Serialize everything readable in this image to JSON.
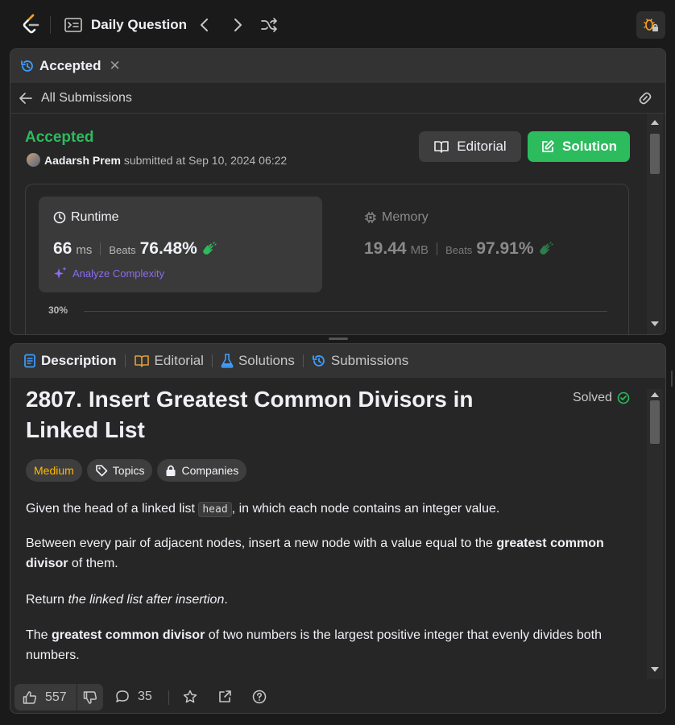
{
  "nav": {
    "title": "Daily Question",
    "logo_icon": "leetcode-logo-icon",
    "list_icon": "list-icon",
    "prev_icon": "chevron-left-icon",
    "next_icon": "chevron-right-icon",
    "shuffle_icon": "shuffle-icon",
    "debug_icon": "bug-lock-icon"
  },
  "submission_panel": {
    "tab_label": "Accepted",
    "back_label": "All Submissions",
    "status": "Accepted",
    "user": "Aadarsh Prem",
    "submitted_text": "submitted at Sep 10, 2024 06:22",
    "editorial_button": "Editorial",
    "solution_button": "Solution",
    "runtime": {
      "label": "Runtime",
      "value": "66",
      "unit": "ms",
      "beats_label": "Beats",
      "beats_value": "76.48%"
    },
    "memory": {
      "label": "Memory",
      "value": "19.44",
      "unit": "MB",
      "beats_label": "Beats",
      "beats_value": "97.91%"
    },
    "analyze_label": "Analyze Complexity",
    "chart_axis_label": "30%"
  },
  "description_panel": {
    "tabs": [
      {
        "label": "Description",
        "active": true
      },
      {
        "label": "Editorial",
        "active": false
      },
      {
        "label": "Solutions",
        "active": false
      },
      {
        "label": "Submissions",
        "active": false
      }
    ],
    "problem_title": "2807. Insert Greatest Common Divisors in Linked List",
    "solved_label": "Solved",
    "difficulty": "Medium",
    "topics_label": "Topics",
    "companies_label": "Companies",
    "para1_pre": "Given the head of a linked list ",
    "para1_code": "head",
    "para1_post": ", in which each node contains an integer value.",
    "para2_pre": "Between every pair of adjacent nodes, insert a new node with a value equal to the ",
    "para2_bold": "greatest common divisor",
    "para2_post": " of them.",
    "para3_pre": "Return ",
    "para3_italic": "the linked list after insertion",
    "para3_post": ".",
    "para4_pre": "The ",
    "para4_bold": "greatest common divisor",
    "para4_post": " of two numbers is the largest positive integer that evenly divides both numbers.",
    "likes": "557",
    "comments": "35"
  },
  "colors": {
    "accent_green": "#2cbb5d",
    "medium_yellow": "#ffb800",
    "analyze_purple": "#8b6cf0",
    "tab_blue": "#3d9cff",
    "editorial_orange": "#e0a039"
  }
}
